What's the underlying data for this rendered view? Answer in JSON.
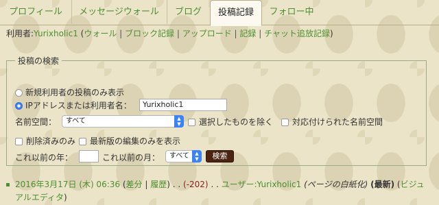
{
  "tabs": [
    {
      "label": "プロフィール"
    },
    {
      "label": "メッセージウォール"
    },
    {
      "label": "ブログ"
    },
    {
      "label": "投稿記録"
    },
    {
      "label": "フォロー中"
    }
  ],
  "user_line": {
    "prefix": "利用者:",
    "username": "Yurixholic1",
    "open_paren": " (",
    "links": [
      "ウォール",
      "ブロック記録",
      "アップロード",
      "記録",
      "チャット追放記録"
    ],
    "separator": " | ",
    "close_paren": ")"
  },
  "search": {
    "legend": "投稿の検索",
    "radio_new_users": "新規利用者の投稿のみ表示",
    "radio_ip_or_user": "IPアドレスまたは利用者名：",
    "target_value": "Yurixholic1",
    "namespace_label": "名前空間：",
    "namespace_value": "すべて",
    "exclude_selected": "選択したものを除く",
    "associated_namespace": "対応付けられた名前空間",
    "deleted_only": "削除済みのみ",
    "latest_only": "最新版の編集のみを表示",
    "year_label": "これ以前の年：",
    "year_value": "",
    "month_label": "これ以前の月：",
    "month_value": "すべて",
    "search_button": "検索"
  },
  "results": [
    {
      "datetime": "2016年3月17日 (木) 06:36",
      "diff_label": "差分",
      "history_label": "履歴",
      "size_change": "(-202)",
      "user_label": "ユーザー:Yurixholic1",
      "summary": "(ページの白紙化)",
      "latest_label": "(最新)",
      "tag_open": " (",
      "tag_label": "ビジュアルエディタ",
      "tag_close": ")"
    }
  ],
  "colors": {
    "link": "#4b8f2f",
    "size_negative": "#8b1a1a",
    "button_bg": "#4a2410",
    "select_accent": "#3b82f6"
  }
}
